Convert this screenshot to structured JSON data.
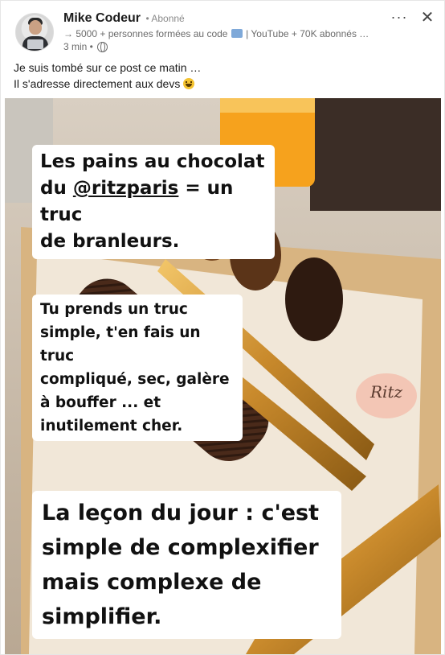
{
  "author": {
    "name": "Mike Codeur",
    "follow_status": "• Abonné",
    "subtitle": "→ 5000 + personnes formées au code",
    "subtitle_rest": "| YouTube + 70K abonnés …",
    "time": "3 min •"
  },
  "actions": {
    "more": "···",
    "close": "✕"
  },
  "post": {
    "line1": "Je suis tombé sur ce post ce matin …",
    "line2": "Il s'adresse directement aux devs"
  },
  "image": {
    "caption1_a": "Les pains au chocolat",
    "caption1_b_pre": "du ",
    "caption1_b_handle": "@ritzparis",
    "caption1_b_post": " = un truc",
    "caption1_c": "de branleurs.",
    "caption2": [
      "Tu prends un truc",
      "simple, t'en fais un truc",
      "compliqué, sec, galère",
      "à bouffer ... et",
      "inutilement cher."
    ],
    "caption3": [
      "La leçon du jour : c'est",
      "simple de complexifier",
      "mais complexe de",
      "simplifier."
    ],
    "plate_script": "Ritz"
  },
  "colors": {
    "name_text": "#1d1d1d",
    "secondary_text": "#6b6b6b",
    "caption_bg": "#ffffff"
  },
  "icons": [
    "avatar",
    "globe-icon",
    "more-icon",
    "close-icon",
    "smile-emoji-icon"
  ]
}
